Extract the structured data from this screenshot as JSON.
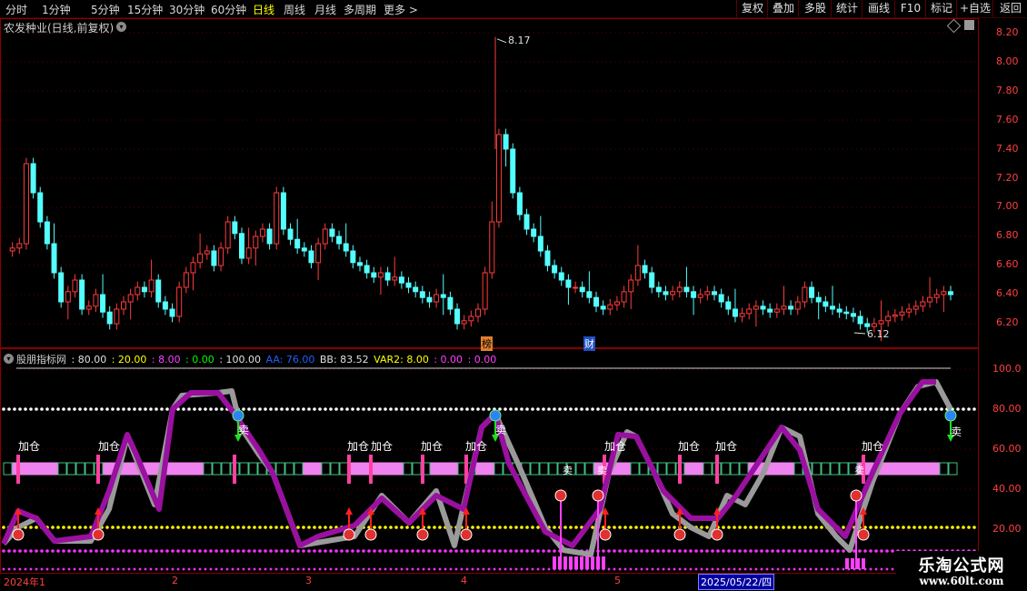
{
  "toolbar": {
    "periods": [
      "分时",
      "1分钟",
      "5分钟",
      "15分钟",
      "30分钟",
      "60分钟",
      "日线",
      "周线",
      "月线",
      "多周期",
      "更多 >"
    ],
    "active_period": "日线",
    "right_buttons": [
      "复权",
      "叠加",
      "多股",
      "统计",
      "画线",
      "F10",
      "标记",
      "+自选",
      "返回"
    ]
  },
  "main_chart": {
    "title": "农发种业(日线,前复权)",
    "price_ticks": [
      "8.20",
      "8.00",
      "7.80",
      "7.60",
      "7.40",
      "7.20",
      "7.00",
      "6.80",
      "6.60",
      "6.40",
      "6.20"
    ],
    "high_label": "8.17",
    "low_label": "6.12",
    "markers": [
      "榜",
      "财"
    ]
  },
  "indicator": {
    "name": "股朋指标网",
    "values": [
      {
        "text": ": 80.00",
        "color": "#e0e0e0"
      },
      {
        "text": ": 20.00",
        "color": "#ffff00"
      },
      {
        "text": ": 8.00",
        "color": "#ff40ff"
      },
      {
        "text": ": 0.00",
        "color": "#00ff00"
      },
      {
        "text": ": 100.00",
        "color": "#e0e0e0"
      },
      {
        "text": "AA: 76.00",
        "color": "#2060ff"
      },
      {
        "text": "BB: 83.52",
        "color": "#e0e0e0"
      },
      {
        "text": "VAR2: 8.00",
        "color": "#ffff00"
      },
      {
        "text": ": 0.00",
        "color": "#ff40ff"
      },
      {
        "text": ": 0.00",
        "color": "#ff40ff"
      }
    ],
    "ticks": [
      "100.0",
      "80.00",
      "60.00",
      "40.00",
      "20.00"
    ],
    "add_label": "加仓",
    "sell_label": "卖",
    "sell_small": "卖"
  },
  "time_axis": {
    "labels": [
      "2024年1",
      "2",
      "3",
      "4",
      "5"
    ],
    "cursor_date": "2025/05/22/四"
  },
  "watermark": {
    "line1": "乐淘公式网",
    "line2": "www.60lt.com"
  },
  "colors": {
    "up": "#ff3c3c",
    "down": "#54ffff",
    "axis": "#8a0000",
    "purple": "#9a10a0",
    "gray": "#9a9a9a",
    "pink": "#ee82ee"
  }
}
